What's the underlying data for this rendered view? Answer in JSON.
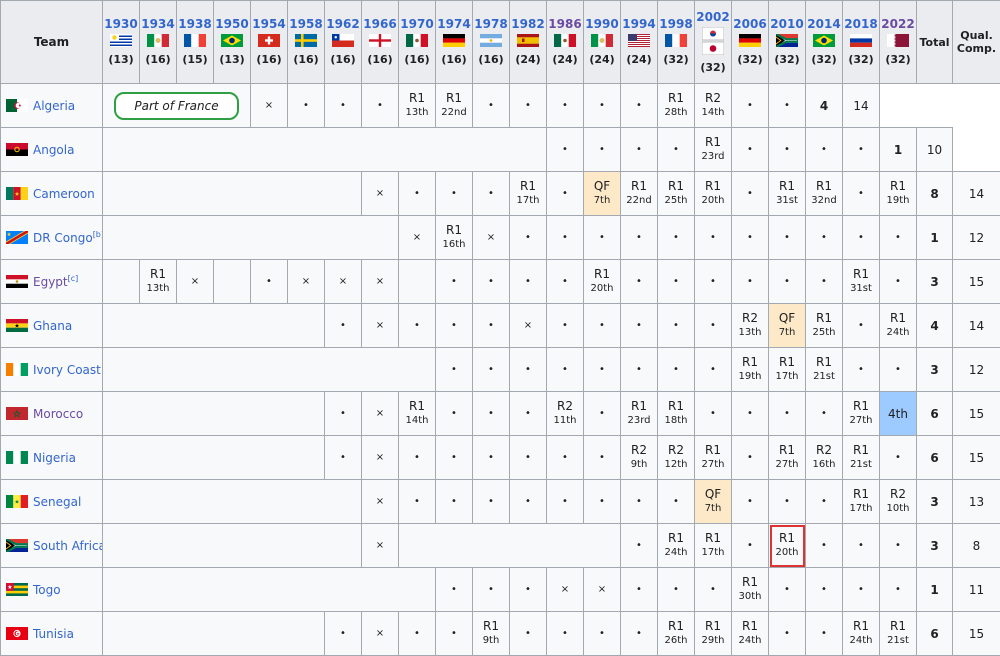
{
  "header": {
    "team": "Team",
    "total": "Total",
    "qual_line1": "Qual.",
    "qual_line2": "Comp.",
    "years": [
      {
        "year": "1930",
        "count": "(13)",
        "flag": "uruguay"
      },
      {
        "year": "1934",
        "count": "(16)",
        "flag": "italy"
      },
      {
        "year": "1938",
        "count": "(15)",
        "flag": "france"
      },
      {
        "year": "1950",
        "count": "(13)",
        "flag": "brazil"
      },
      {
        "year": "1954",
        "count": "(16)",
        "flag": "switzerland"
      },
      {
        "year": "1958",
        "count": "(16)",
        "flag": "sweden"
      },
      {
        "year": "1962",
        "count": "(16)",
        "flag": "chile"
      },
      {
        "year": "1966",
        "count": "(16)",
        "flag": "england"
      },
      {
        "year": "1970",
        "count": "(16)",
        "flag": "mexico"
      },
      {
        "year": "1974",
        "count": "(16)",
        "flag": "germany"
      },
      {
        "year": "1978",
        "count": "(16)",
        "flag": "argentina"
      },
      {
        "year": "1982",
        "count": "(24)",
        "flag": "spain"
      },
      {
        "year": "1986",
        "count": "(24)",
        "flag": "mexico"
      },
      {
        "year": "1990",
        "count": "(24)",
        "flag": "italy"
      },
      {
        "year": "1994",
        "count": "(24)",
        "flag": "usa"
      },
      {
        "year": "1998",
        "count": "(32)",
        "flag": "france"
      },
      {
        "year": "2002",
        "count": "(32)",
        "flag": "korea-japan"
      },
      {
        "year": "2006",
        "count": "(32)",
        "flag": "germany"
      },
      {
        "year": "2010",
        "count": "(32)",
        "flag": "south-africa"
      },
      {
        "year": "2014",
        "count": "(32)",
        "flag": "brazil"
      },
      {
        "year": "2018",
        "count": "(32)",
        "flag": "russia"
      },
      {
        "year": "2022",
        "count": "(32)",
        "flag": "qatar"
      }
    ]
  },
  "part_of_france": "Part of France",
  "rows": [
    {
      "team": "Algeria",
      "sup": "",
      "flag": "algeria",
      "total": "4",
      "qual": "14",
      "visited": false,
      "cells": [
        [
          "pof",
          4
        ],
        [
          "x"
        ],
        [
          "dot"
        ],
        [
          "dot"
        ],
        [
          "dot"
        ],
        [
          "R1",
          "13th"
        ],
        [
          "R1",
          "22nd"
        ],
        [
          "dot"
        ],
        [
          "dot"
        ],
        [
          "dot"
        ],
        [
          "dot"
        ],
        [
          "dot"
        ],
        [
          "R1",
          "28th"
        ],
        [
          "R2",
          "14th"
        ],
        [
          "dot"
        ],
        [
          "dot"
        ]
      ]
    },
    {
      "team": "Angola",
      "sup": "",
      "flag": "angola",
      "total": "1",
      "qual": "10",
      "visited": false,
      "cells": [
        [
          "empty",
          12
        ],
        [
          "dot"
        ],
        [
          "dot"
        ],
        [
          "dot"
        ],
        [
          "dot"
        ],
        [
          "R1",
          "23rd"
        ],
        [
          "dot"
        ],
        [
          "dot"
        ],
        [
          "dot"
        ],
        [
          "dot"
        ]
      ]
    },
    {
      "team": "Cameroon",
      "sup": "",
      "flag": "cameroon",
      "total": "8",
      "qual": "14",
      "visited": false,
      "cells": [
        [
          "empty",
          7
        ],
        [
          "x"
        ],
        [
          "dot"
        ],
        [
          "dot"
        ],
        [
          "dot"
        ],
        [
          "R1",
          "17th"
        ],
        [
          "dot"
        ],
        [
          "QF",
          "7th",
          "qf"
        ],
        [
          "R1",
          "22nd"
        ],
        [
          "R1",
          "25th"
        ],
        [
          "R1",
          "20th"
        ],
        [
          "dot"
        ],
        [
          "R1",
          "31st"
        ],
        [
          "R1",
          "32nd"
        ],
        [
          "dot"
        ],
        [
          "R1",
          "19th"
        ]
      ]
    },
    {
      "team": "DR Congo",
      "sup": "[b]",
      "flag": "drcongo",
      "total": "1",
      "qual": "12",
      "visited": false,
      "cells": [
        [
          "empty",
          8
        ],
        [
          "x"
        ],
        [
          "R1",
          "16th"
        ],
        [
          "x"
        ],
        [
          "dot"
        ],
        [
          "dot"
        ],
        [
          "dot"
        ],
        [
          "dot"
        ],
        [
          "dot"
        ],
        [
          "dot"
        ],
        [
          "dot"
        ],
        [
          "dot"
        ],
        [
          "dot"
        ],
        [
          "dot"
        ],
        [
          "dot"
        ]
      ]
    },
    {
      "team": "Egypt",
      "sup": "[c]",
      "flag": "egypt",
      "total": "3",
      "qual": "15",
      "visited": true,
      "cells": [
        [
          "empty",
          1
        ],
        [
          "R1",
          "13th"
        ],
        [
          "x"
        ],
        [
          "empty",
          1
        ],
        [
          "dot"
        ],
        [
          "x"
        ],
        [
          "x"
        ],
        [
          "x"
        ],
        [
          "empty",
          1
        ],
        [
          "dot"
        ],
        [
          "dot"
        ],
        [
          "dot"
        ],
        [
          "dot"
        ],
        [
          "R1",
          "20th"
        ],
        [
          "dot"
        ],
        [
          "dot"
        ],
        [
          "dot"
        ],
        [
          "dot"
        ],
        [
          "dot"
        ],
        [
          "dot"
        ],
        [
          "R1",
          "31st"
        ],
        [
          "dot"
        ]
      ]
    },
    {
      "team": "Ghana",
      "sup": "",
      "flag": "ghana",
      "total": "4",
      "qual": "14",
      "visited": false,
      "cells": [
        [
          "empty",
          6
        ],
        [
          "dot"
        ],
        [
          "x"
        ],
        [
          "dot"
        ],
        [
          "dot"
        ],
        [
          "dot"
        ],
        [
          "x"
        ],
        [
          "dot"
        ],
        [
          "dot"
        ],
        [
          "dot"
        ],
        [
          "dot"
        ],
        [
          "dot"
        ],
        [
          "R2",
          "13th"
        ],
        [
          "QF",
          "7th",
          "qf"
        ],
        [
          "R1",
          "25th"
        ],
        [
          "dot"
        ],
        [
          "R1",
          "24th"
        ]
      ]
    },
    {
      "team": "Ivory Coast",
      "sup": "",
      "flag": "ivorycoast",
      "total": "3",
      "qual": "12",
      "visited": false,
      "cells": [
        [
          "empty",
          9
        ],
        [
          "dot"
        ],
        [
          "dot"
        ],
        [
          "dot"
        ],
        [
          "dot"
        ],
        [
          "dot"
        ],
        [
          "dot"
        ],
        [
          "dot"
        ],
        [
          "dot"
        ],
        [
          "R1",
          "19th"
        ],
        [
          "R1",
          "17th"
        ],
        [
          "R1",
          "21st"
        ],
        [
          "dot"
        ],
        [
          "dot"
        ]
      ]
    },
    {
      "team": "Morocco",
      "sup": "",
      "flag": "morocco",
      "total": "6",
      "qual": "15",
      "visited": true,
      "cells": [
        [
          "empty",
          6
        ],
        [
          "dot"
        ],
        [
          "x"
        ],
        [
          "R1",
          "14th"
        ],
        [
          "dot"
        ],
        [
          "dot"
        ],
        [
          "dot"
        ],
        [
          "R2",
          "11th"
        ],
        [
          "dot"
        ],
        [
          "R1",
          "23rd"
        ],
        [
          "R1",
          "18th"
        ],
        [
          "dot"
        ],
        [
          "dot"
        ],
        [
          "dot"
        ],
        [
          "dot"
        ],
        [
          "R1",
          "27th"
        ],
        [
          "4th",
          "",
          "semi"
        ]
      ]
    },
    {
      "team": "Nigeria",
      "sup": "",
      "flag": "nigeria",
      "total": "6",
      "qual": "15",
      "visited": false,
      "cells": [
        [
          "empty",
          6
        ],
        [
          "dot"
        ],
        [
          "x"
        ],
        [
          "dot"
        ],
        [
          "dot"
        ],
        [
          "dot"
        ],
        [
          "dot"
        ],
        [
          "dot"
        ],
        [
          "dot"
        ],
        [
          "R2",
          "9th"
        ],
        [
          "R2",
          "12th"
        ],
        [
          "R1",
          "27th"
        ],
        [
          "dot"
        ],
        [
          "R1",
          "27th"
        ],
        [
          "R2",
          "16th"
        ],
        [
          "R1",
          "21st"
        ],
        [
          "dot"
        ]
      ]
    },
    {
      "team": "Senegal",
      "sup": "",
      "flag": "senegal",
      "total": "3",
      "qual": "13",
      "visited": false,
      "cells": [
        [
          "empty",
          7
        ],
        [
          "x"
        ],
        [
          "dot"
        ],
        [
          "dot"
        ],
        [
          "dot"
        ],
        [
          "dot"
        ],
        [
          "dot"
        ],
        [
          "dot"
        ],
        [
          "dot"
        ],
        [
          "dot"
        ],
        [
          "QF",
          "7th",
          "qf"
        ],
        [
          "dot"
        ],
        [
          "dot"
        ],
        [
          "dot"
        ],
        [
          "R1",
          "17th"
        ],
        [
          "R2",
          "10th"
        ]
      ]
    },
    {
      "team": "South Africa",
      "sup": "",
      "flag": "southafrica",
      "total": "3",
      "qual": "8",
      "visited": false,
      "cells": [
        [
          "empty",
          7
        ],
        [
          "x"
        ],
        [
          "empty",
          6
        ],
        [
          "dot"
        ],
        [
          "R1",
          "24th"
        ],
        [
          "R1",
          "17th"
        ],
        [
          "dot"
        ],
        [
          "R1",
          "20th",
          "hl"
        ],
        [
          "dot"
        ],
        [
          "dot"
        ],
        [
          "dot"
        ]
      ]
    },
    {
      "team": "Togo",
      "sup": "",
      "flag": "togo",
      "total": "1",
      "qual": "11",
      "visited": false,
      "cells": [
        [
          "empty",
          9
        ],
        [
          "dot"
        ],
        [
          "dot"
        ],
        [
          "dot"
        ],
        [
          "x"
        ],
        [
          "x"
        ],
        [
          "dot"
        ],
        [
          "dot"
        ],
        [
          "dot"
        ],
        [
          "R1",
          "30th"
        ],
        [
          "dot"
        ],
        [
          "dot"
        ],
        [
          "dot"
        ],
        [
          "dot"
        ]
      ]
    },
    {
      "team": "Tunisia",
      "sup": "",
      "flag": "tunisia",
      "total": "6",
      "qual": "15",
      "visited": false,
      "cells": [
        [
          "empty",
          6
        ],
        [
          "dot"
        ],
        [
          "x"
        ],
        [
          "dot"
        ],
        [
          "dot"
        ],
        [
          "R1",
          "9th"
        ],
        [
          "dot"
        ],
        [
          "dot"
        ],
        [
          "dot"
        ],
        [
          "dot"
        ],
        [
          "R1",
          "26th"
        ],
        [
          "R1",
          "29th"
        ],
        [
          "R1",
          "24th"
        ],
        [
          "dot"
        ],
        [
          "dot"
        ],
        [
          "R1",
          "24th"
        ],
        [
          "R1",
          "21st"
        ]
      ]
    }
  ],
  "symbols": {
    "dot": "•",
    "x": "×"
  },
  "colors": {
    "link": "#3366cc",
    "visited": "#6b4ba1",
    "qf": "#fde9c8",
    "semi": "#9ecbff",
    "highlight": "#d33333",
    "oval": "#2ea043"
  }
}
